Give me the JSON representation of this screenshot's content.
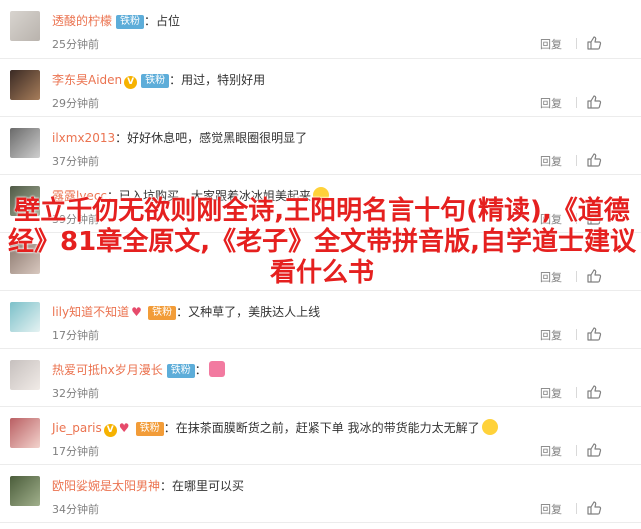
{
  "comments": [
    {
      "username": "透酸的柠檬",
      "badge": "铁粉",
      "badge_type": "blue",
      "vip": false,
      "text": "占位",
      "time": "25分钟前",
      "reply": "回复",
      "likes": "",
      "avatar_colors": [
        "#d8d4cf",
        "#b9b3ad"
      ]
    },
    {
      "username": "李东昊Aiden",
      "badge": "铁粉",
      "badge_type": "blue",
      "vip": true,
      "text": "用过，特别好用",
      "time": "29分钟前",
      "reply": "回复",
      "likes": "",
      "avatar_colors": [
        "#3a2a24",
        "#a77d5a"
      ]
    },
    {
      "username": "ilxmx2013",
      "badge": "",
      "badge_type": "",
      "vip": false,
      "text": "好好休息吧，感觉黑眼圈很明显了",
      "time": "37分钟前",
      "reply": "回复",
      "likes": "",
      "avatar_colors": [
        "#6a6a6a",
        "#cfcfcf"
      ]
    },
    {
      "username": "露露lvecc",
      "badge": "",
      "badge_type": "",
      "vip": false,
      "text": "已入坑购买，大家跟着冰冰姐美起来",
      "time": "39分钟前",
      "reply": "回复",
      "likes": "",
      "avatar_colors": [
        "#4f5a46",
        "#a8b19a"
      ]
    },
    {
      "username": "",
      "badge": "",
      "badge_type": "",
      "vip": false,
      "text": "",
      "time": "",
      "reply": "回复",
      "likes": "",
      "avatar_colors": [
        "#8d7a70",
        "#d8c8bf"
      ]
    },
    {
      "username": "lily知道不知道",
      "badge": "铁粉",
      "badge_type": "gold",
      "vip": false,
      "text": "又种草了，美肤达人上线",
      "time": "17分钟前",
      "reply": "回复",
      "likes": "",
      "avatar_colors": [
        "#7cc0c9",
        "#e5f2f2"
      ]
    },
    {
      "username": "热爱可抵hx岁月漫长",
      "badge": "铁粉",
      "badge_type": "blue",
      "vip": false,
      "text": "",
      "time": "32分钟前",
      "reply": "回复",
      "likes": "",
      "avatar_colors": [
        "#c6c0be",
        "#f1ebe7"
      ]
    },
    {
      "username": "Jie_paris",
      "badge": "铁粉",
      "badge_type": "gold",
      "vip": true,
      "text": "在抹茶面膜断货之前，赶紧下单 我冰的带货能力太无解了",
      "time": "17分钟前",
      "reply": "回复",
      "likes": "",
      "avatar_colors": [
        "#b95f63",
        "#f3d3cd"
      ]
    },
    {
      "username": "欧阳娑婉是太阳男神",
      "badge": "",
      "badge_type": "",
      "vip": false,
      "text": "在哪里可以买",
      "time": "34分钟前",
      "reply": "回复",
      "likes": "",
      "avatar_colors": [
        "#4b5d3b",
        "#a1b08c"
      ]
    }
  ],
  "overlay_text": "壁立千仞无欲则刚全诗,王阳明名言十句(精读),《道德经》81章全原文,《老子》全文带拼音版,自学道士建议看什么书",
  "colors": {
    "username": "#eb7350",
    "accent_red": "#e5201f",
    "badge_blue": "#5dadd9",
    "badge_gold": "#f29c38"
  }
}
